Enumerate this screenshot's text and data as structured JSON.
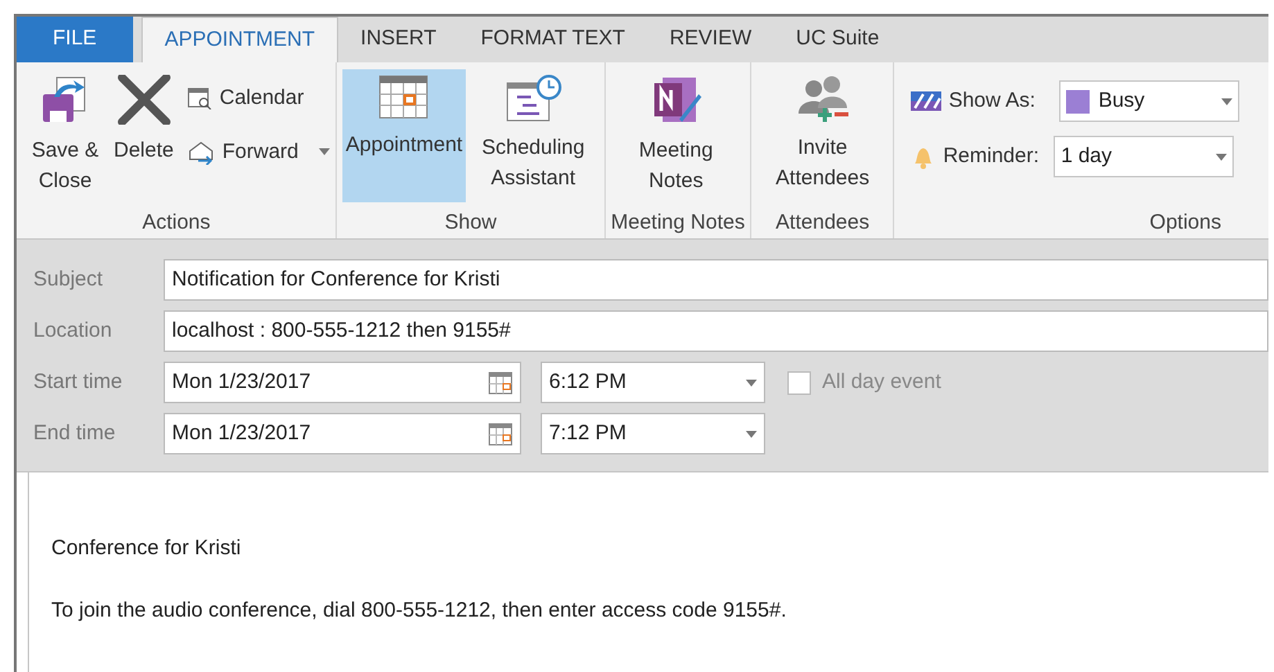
{
  "tabs": [
    {
      "label": "FILE",
      "kind": "file",
      "selected": false
    },
    {
      "label": "APPOINTMENT",
      "kind": "tab",
      "selected": true
    },
    {
      "label": "INSERT",
      "kind": "tab",
      "selected": false
    },
    {
      "label": "FORMAT TEXT",
      "kind": "tab",
      "selected": false
    },
    {
      "label": "REVIEW",
      "kind": "tab",
      "selected": false
    },
    {
      "label": "UC Suite",
      "kind": "tab",
      "selected": false
    }
  ],
  "ribbon": {
    "groups": [
      {
        "label": "Actions",
        "items": [
          {
            "kind": "large",
            "label": "Save & Close"
          },
          {
            "kind": "large",
            "label": "Delete"
          },
          {
            "kind": "stack",
            "items": [
              {
                "label": "Calendar",
                "dropdown": false
              },
              {
                "label": "Forward",
                "dropdown": true
              }
            ]
          }
        ]
      },
      {
        "label": "Show",
        "items": [
          {
            "kind": "large",
            "label": "Appointment",
            "selected": true
          },
          {
            "kind": "large",
            "label": "Scheduling Assistant",
            "selected": false
          }
        ]
      },
      {
        "label": "Meeting Notes",
        "items": [
          {
            "kind": "large",
            "label": "Meeting Notes"
          }
        ]
      },
      {
        "label": "Attendees",
        "items": [
          {
            "kind": "large",
            "label": "Invite Attendees"
          }
        ]
      },
      {
        "label": "Options",
        "items": [
          {
            "kind": "options",
            "rows": [
              {
                "label": "Show As:",
                "value": "Busy",
                "color": "#9b7fd4"
              },
              {
                "label": "Reminder:",
                "value": "1 day"
              }
            ]
          }
        ]
      }
    ]
  },
  "form": {
    "subject": {
      "label": "Subject",
      "value": "Notification for Conference for Kristi"
    },
    "location": {
      "label": "Location",
      "value": "localhost : 800-555-1212 then 9155#"
    },
    "start": {
      "label": "Start time",
      "date": "Mon 1/23/2017",
      "time": "6:12 PM"
    },
    "end": {
      "label": "End time",
      "date": "Mon 1/23/2017",
      "time": "7:12 PM"
    },
    "all_day": {
      "label": "All day event",
      "checked": false
    }
  },
  "body": [
    "Conference for Kristi",
    "To join the audio conference, dial 800-555-1212, then enter access code 9155#."
  ]
}
